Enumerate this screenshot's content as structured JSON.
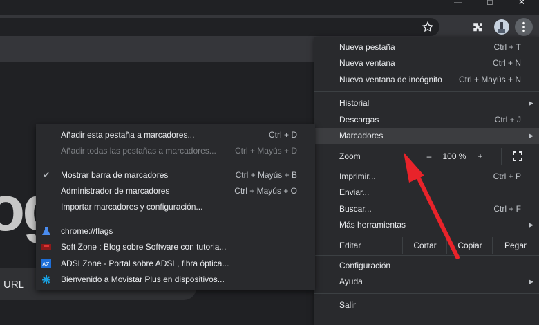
{
  "window": {
    "minimize": "—",
    "maximize": "□",
    "close": "✕"
  },
  "page": {
    "big_text": "og",
    "url_label": "URL"
  },
  "main_menu": {
    "items": [
      {
        "label": "Nueva pestaña",
        "shortcut": "Ctrl + T"
      },
      {
        "label": "Nueva ventana",
        "shortcut": "Ctrl + N"
      },
      {
        "label": "Nueva ventana de incógnito",
        "shortcut": "Ctrl + Mayús + N"
      },
      {
        "label": "Historial",
        "shortcut": ""
      },
      {
        "label": "Descargas",
        "shortcut": "Ctrl + J"
      },
      {
        "label": "Marcadores",
        "shortcut": ""
      },
      {
        "label": "Imprimir...",
        "shortcut": "Ctrl + P"
      },
      {
        "label": "Enviar...",
        "shortcut": ""
      },
      {
        "label": "Buscar...",
        "shortcut": "Ctrl + F"
      },
      {
        "label": "Más herramientas",
        "shortcut": ""
      },
      {
        "label": "Configuración",
        "shortcut": ""
      },
      {
        "label": "Ayuda",
        "shortcut": ""
      },
      {
        "label": "Salir",
        "shortcut": ""
      }
    ],
    "zoom": {
      "label": "Zoom",
      "minus": "–",
      "value": "100 %",
      "plus": "+"
    },
    "edit": {
      "label": "Editar",
      "cut": "Cortar",
      "copy": "Copiar",
      "paste": "Pegar"
    }
  },
  "bookmarks_menu": {
    "items": [
      {
        "label": "Añadir esta pestaña a marcadores...",
        "shortcut": "Ctrl + D"
      },
      {
        "label": "Añadir todas las pestañas a marcadores...",
        "shortcut": "Ctrl + Mayús + D"
      },
      {
        "label": "Mostrar barra de marcadores",
        "shortcut": "Ctrl + Mayús + B"
      },
      {
        "label": "Administrador de marcadores",
        "shortcut": "Ctrl + Mayús + O"
      },
      {
        "label": "Importar marcadores y configuración...",
        "shortcut": ""
      },
      {
        "label": "chrome://flags",
        "shortcut": ""
      },
      {
        "label": "Soft Zone : Blog sobre Software con tutoria...",
        "shortcut": ""
      },
      {
        "label": "ADSLZone - Portal sobre ADSL, fibra óptica...",
        "shortcut": ""
      },
      {
        "label": "Bienvenido a Movistar Plus en dispositivos...",
        "shortcut": ""
      }
    ],
    "check": "✔"
  },
  "colors": {
    "arrow": "#e8232a",
    "menu_bg": "#292a2d",
    "highlight": "#3c3d40"
  }
}
